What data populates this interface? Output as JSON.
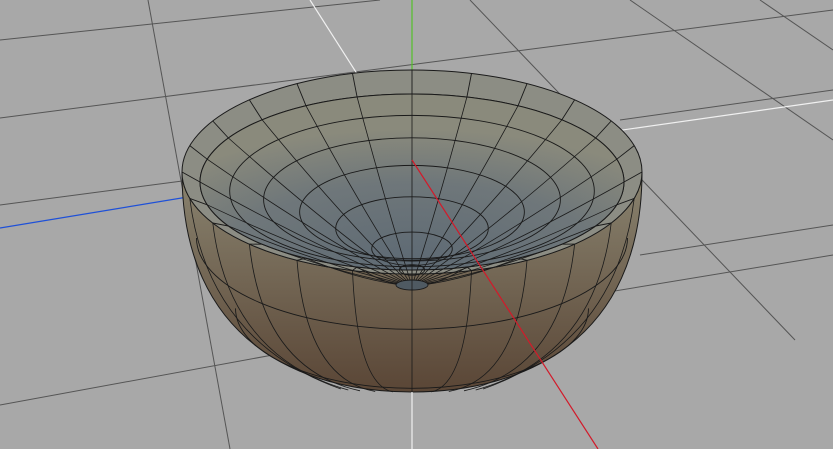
{
  "viewport": {
    "mode": "perspective",
    "background_color": "#a8a8a8",
    "grid_color": "#555555",
    "grid_visible": true
  },
  "axes": {
    "x_axis_color": "#d21a2a",
    "y_axis_color": "#54c12a",
    "z_axis_color": "#1e50d8",
    "negative_axis_color": "#f0f0f0"
  },
  "mesh": {
    "name": "bowl",
    "shape": "hemisphere-shell",
    "outer_color_top": "#8a8470",
    "outer_color_bottom": "#5a4636",
    "inner_color_rim": "#8a8a7c",
    "inner_color_bottom": "#5e6a74",
    "rim_color": "#8c8d84",
    "wireframe_color": "#1a1a1a",
    "segments": 24
  }
}
